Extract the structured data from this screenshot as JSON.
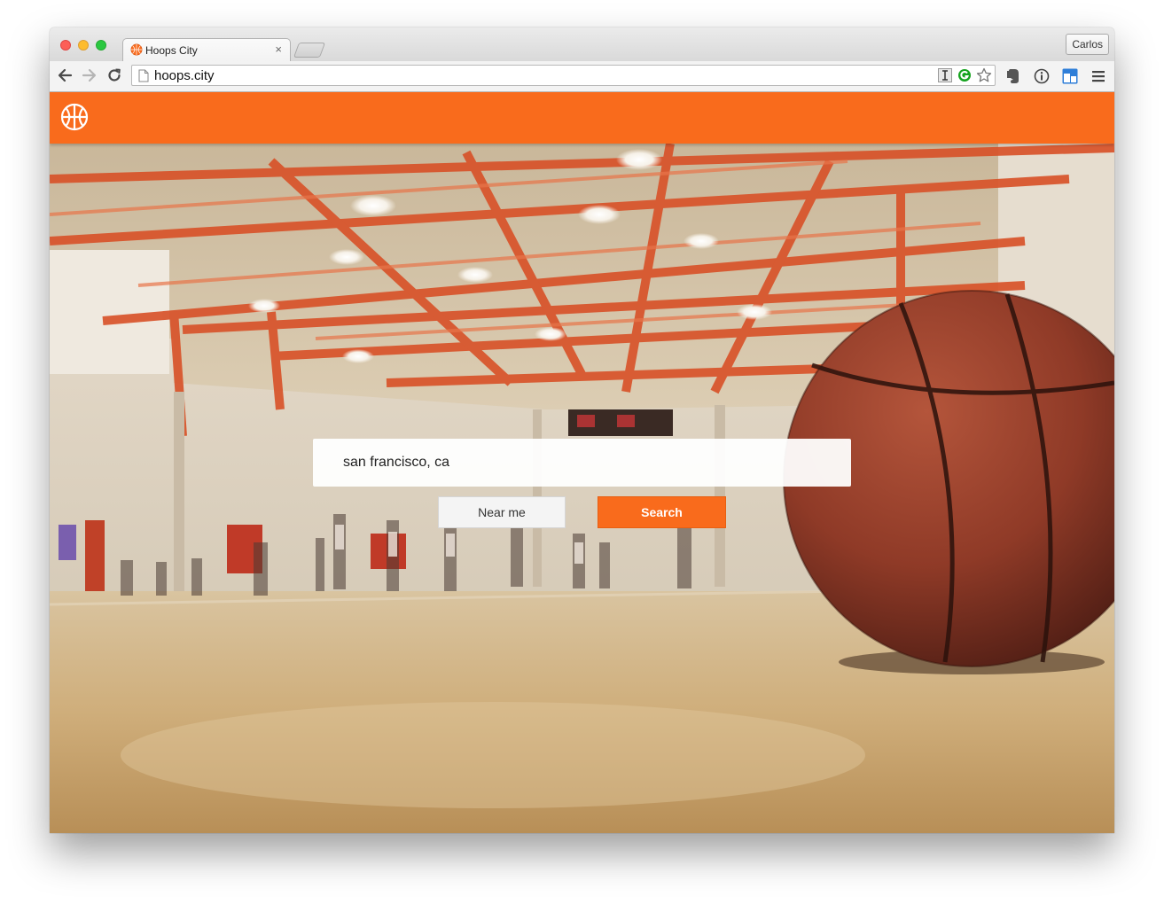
{
  "browser": {
    "tab_title": "Hoops City",
    "tab_close_glyph": "×",
    "profile_name": "Carlos",
    "url": "hoops.city",
    "icons": {
      "back": "arrow-left-icon",
      "forward": "arrow-right-icon",
      "reload": "reload-icon",
      "page": "page-icon",
      "bookmark": "star-icon",
      "menu": "hamburger-menu-icon"
    }
  },
  "site": {
    "brand_color": "#f96b1c",
    "logo": "basketball-icon"
  },
  "hero": {
    "search_value": "san francisco, ca",
    "near_me_label": "Near me",
    "search_label": "Search"
  }
}
